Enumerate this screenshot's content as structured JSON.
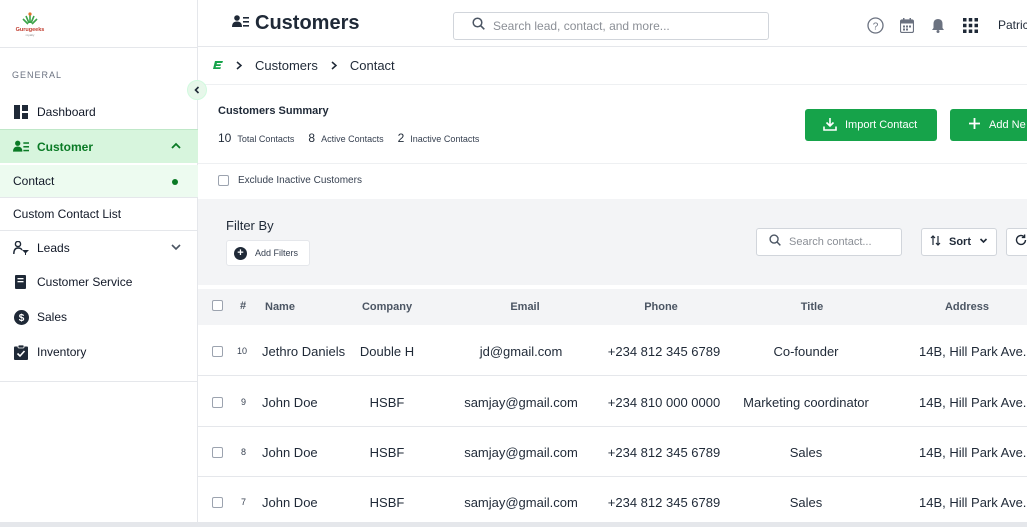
{
  "brand": {
    "logo_text": "Gurugeeks",
    "logo_sub": "royalty"
  },
  "sidebar": {
    "section_label": "GENERAL",
    "items": [
      {
        "label": "Dashboard"
      },
      {
        "label": "Customer"
      },
      {
        "label": "Leads"
      },
      {
        "label": "Customer Service"
      },
      {
        "label": "Sales"
      },
      {
        "label": "Inventory"
      }
    ],
    "sub_items": [
      {
        "label": "Contact"
      },
      {
        "label": "Custom Contact List"
      }
    ]
  },
  "header": {
    "title": "Customers",
    "search_placeholder": "Search lead, contact, and more...",
    "user_name": "Patric"
  },
  "breadcrumb": {
    "items": [
      "Customers",
      "Contact"
    ]
  },
  "summary": {
    "title": "Customers Summary",
    "stats": [
      {
        "value": "10",
        "label": "Total Contacts"
      },
      {
        "value": "8",
        "label": "Active Contacts"
      },
      {
        "value": "2",
        "label": "Inactive Contacts"
      }
    ],
    "import_label": "Import Contact",
    "add_label": "Add Ne"
  },
  "exclude_label": "Exclude Inactive Customers",
  "filter": {
    "title": "Filter By",
    "add_filters_label": "Add Filters",
    "search_placeholder": "Search contact...",
    "sort_label": "Sort"
  },
  "table": {
    "columns": [
      "#",
      "Name",
      "Company",
      "Email",
      "Phone",
      "Title",
      "Address"
    ],
    "rows": [
      {
        "idx": "10",
        "name": "Jethro Daniels",
        "company": "Double H",
        "email": "jd@gmail.com",
        "phone": "+234 812 345 6789",
        "title": "Co-founder",
        "address": "14B, Hill Park Ave."
      },
      {
        "idx": "9",
        "name": "John Doe",
        "company": "HSBF",
        "email": "samjay@gmail.com",
        "phone": "+234 810 000 0000",
        "title": "Marketing coordinator",
        "address": "14B, Hill Park Ave."
      },
      {
        "idx": "8",
        "name": "John Doe",
        "company": "HSBF",
        "email": "samjay@gmail.com",
        "phone": "+234 812 345 6789",
        "title": "Sales",
        "address": "14B, Hill Park Ave."
      },
      {
        "idx": "7",
        "name": "John Doe",
        "company": "HSBF",
        "email": "samjay@gmail.com",
        "phone": "+234 812 345 6789",
        "title": "Sales",
        "address": "14B, Hill Park Ave."
      }
    ]
  },
  "colors": {
    "accent": "#16a34a",
    "accent_dark": "#0a7a25",
    "active_bg": "#d7f5dd"
  }
}
